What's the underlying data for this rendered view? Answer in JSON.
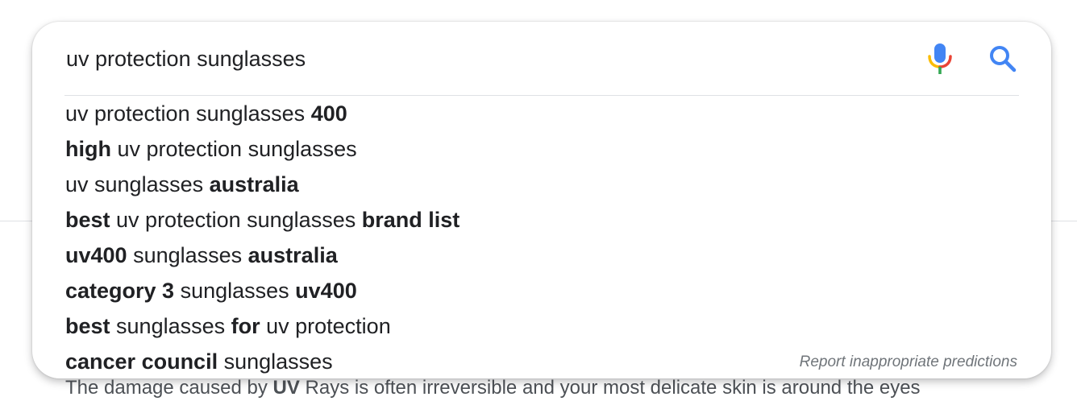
{
  "search": {
    "query": "uv protection sunglasses",
    "mic_icon": "microphone-icon",
    "search_icon": "magnifier-icon"
  },
  "suggestions": [
    [
      {
        "t": "uv protection sunglasses ",
        "b": false
      },
      {
        "t": "400",
        "b": true
      }
    ],
    [
      {
        "t": "high",
        "b": true
      },
      {
        "t": " uv protection sunglasses",
        "b": false
      }
    ],
    [
      {
        "t": "uv sunglasses ",
        "b": false
      },
      {
        "t": "australia",
        "b": true
      }
    ],
    [
      {
        "t": "best",
        "b": true
      },
      {
        "t": " uv protection sunglasses ",
        "b": false
      },
      {
        "t": "brand list",
        "b": true
      }
    ],
    [
      {
        "t": "uv400",
        "b": true
      },
      {
        "t": " sunglasses ",
        "b": false
      },
      {
        "t": "australia",
        "b": true
      }
    ],
    [
      {
        "t": "category 3",
        "b": true
      },
      {
        "t": " sunglasses ",
        "b": false
      },
      {
        "t": "uv400",
        "b": true
      }
    ],
    [
      {
        "t": "best",
        "b": true
      },
      {
        "t": " sunglasses ",
        "b": false
      },
      {
        "t": "for",
        "b": true
      },
      {
        "t": " uv protection",
        "b": false
      }
    ],
    [
      {
        "t": "cancer council",
        "b": true
      },
      {
        "t": " sunglasses",
        "b": false
      }
    ]
  ],
  "report_link": "Report inappropriate predictions",
  "background": {
    "snippet": [
      {
        "t": "The damage caused by ",
        "b": false
      },
      {
        "t": "UV",
        "b": true
      },
      {
        "t": " Rays is often irreversible and your most delicate skin is around the eyes",
        "b": false
      }
    ]
  },
  "colors": {
    "text": "#202124",
    "muted": "#70757a",
    "divider": "#dfe1e5",
    "google_blue": "#4285f4",
    "google_red": "#ea4335",
    "google_yellow": "#fbbc04",
    "google_green": "#34a853"
  }
}
